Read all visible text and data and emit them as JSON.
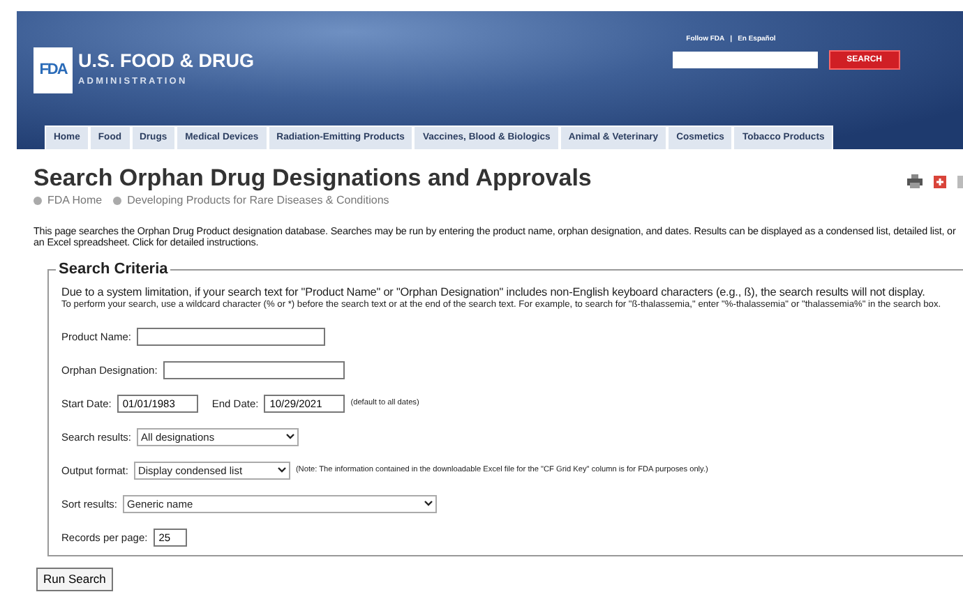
{
  "header": {
    "logo": "FDA",
    "title": "U.S. FOOD & DRUG",
    "subtitle": "ADMINISTRATION",
    "utility_links": [
      "Follow FDA",
      "En Español"
    ],
    "utility_separator": "|",
    "search_button": "SEARCH"
  },
  "nav": [
    {
      "label": "Home"
    },
    {
      "label": "Food"
    },
    {
      "label": "Drugs"
    },
    {
      "label": "Medical Devices"
    },
    {
      "label": "Radiation-Emitting Products"
    },
    {
      "label": "Vaccines, Blood & Biologics"
    },
    {
      "label": "Animal & Veterinary"
    },
    {
      "label": "Cosmetics"
    },
    {
      "label": "Tobacco Products"
    }
  ],
  "page_title": "Search Orphan Drug Designations and Approvals",
  "breadcrumbs": [
    "FDA Home",
    "Developing Products for Rare Diseases & Conditions"
  ],
  "intro": {
    "text": "This page searches the Orphan Drug Product designation database. Searches may be run by entering the product name, orphan designation, and dates. Results can be displayed as a condensed list, detailed list, or an Excel spreadsheet.",
    "link": "Click for detailed instructions."
  },
  "criteria": {
    "legend": "Search Criteria",
    "notice": "Due to a system limitation, if your search text for \"Product Name\" or \"Orphan Designation\" includes non-English keyboard characters (e.g., ß), the search results will not display.",
    "notice_detail": "To perform your search, use a wildcard character (% or *) before the search text or at the end of the search text. For example, to search for \"ß-thalassemia,\" enter \"%-thalassemia\" or \"thalassemia%\" in the search box.",
    "fields": [
      {
        "kind": "text",
        "label": "Product Name:"
      },
      {
        "kind": "text",
        "label": "Orphan Designation:"
      },
      {
        "kind": "dates",
        "start_label": "Start Date:",
        "start_value": "01/01/1983",
        "end_label": "End Date:",
        "end_value": "10/29/2021",
        "note": "(default to all dates)"
      },
      {
        "kind": "select",
        "label": "Search results:",
        "value": "All designations"
      },
      {
        "kind": "select",
        "label": "Output format:",
        "value": "Display condensed list",
        "note": "(Note: The information contained in the downloadable Excel file for the \"CF Grid Key\" column is for FDA purposes only.)"
      },
      {
        "kind": "select",
        "label": "Sort results:",
        "value": "Generic name"
      },
      {
        "kind": "number",
        "label": "Records per page:",
        "value": "25"
      }
    ]
  },
  "run_button": "Run Search"
}
